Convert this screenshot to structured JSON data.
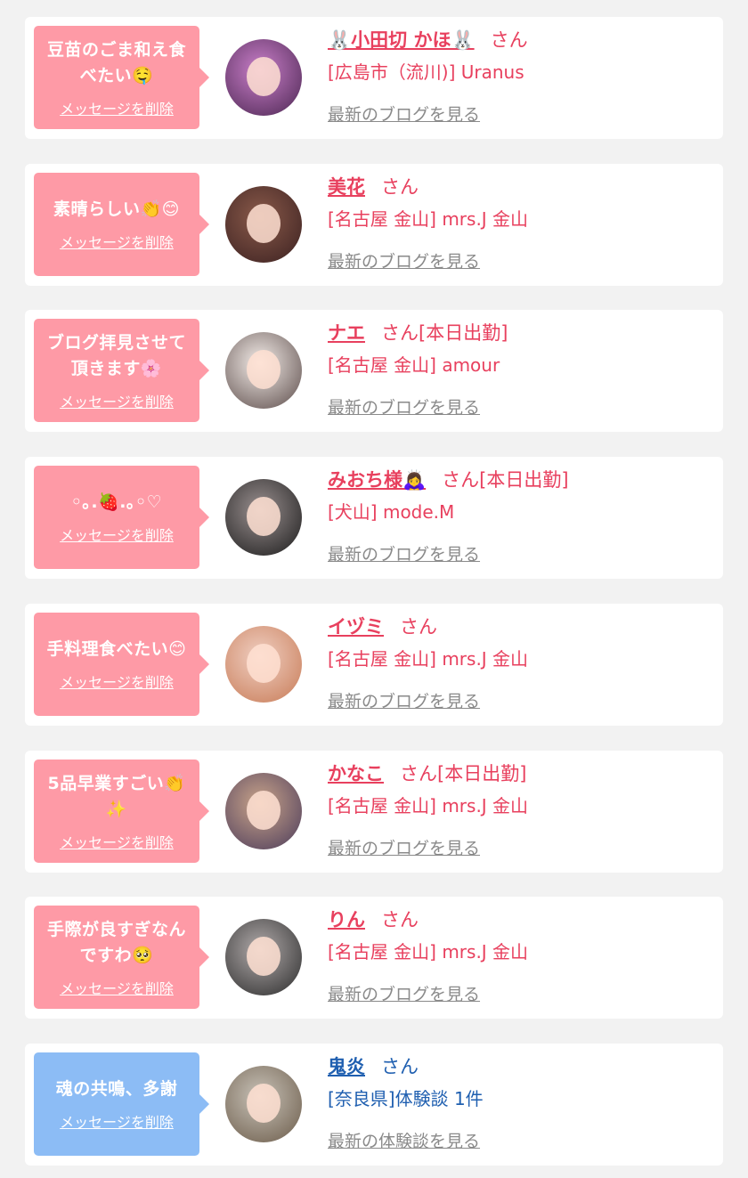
{
  "delete_label": "メッセージを削除",
  "colors": {
    "page_bg": "#f2f2f2",
    "bubble_pink": "#fe9aa6",
    "bubble_blue": "#8cbcf5",
    "text_pink": "#e8405e",
    "text_blue": "#1f5fb0",
    "link_gray": "#8a8a8a"
  },
  "cards": [
    {
      "message": "豆苗のごま和え食べたい🤤",
      "name": "🐰小田切 かほ🐰",
      "suffix": "さん",
      "shop": "[広島市（流川)] Uranus",
      "link": "最新のブログを見る",
      "theme": "pink",
      "avatar_colors": [
        "#c97fc9",
        "#4a2550"
      ]
    },
    {
      "message": "素晴らしい👏😊",
      "name": "美花",
      "suffix": "さん",
      "shop": "[名古屋 金山] mrs.J 金山",
      "link": "最新のブログを見る",
      "theme": "pink",
      "avatar_colors": [
        "#8a5a4a",
        "#3a2020"
      ]
    },
    {
      "message": "ブログ拝見させて頂きます🌸",
      "name": "ナエ",
      "suffix": "さん[本日出勤]",
      "shop": "[名古屋 金山] amour",
      "link": "最新のブログを見る",
      "theme": "pink",
      "avatar_colors": [
        "#f3ece8",
        "#5a4a48"
      ]
    },
    {
      "message": "◦｡.🍓.｡◦♡",
      "name": "みおち様🙇‍♀️",
      "suffix": "さん[本日出勤]",
      "shop": "[犬山] mode.M",
      "link": "最新のブログを見る",
      "theme": "pink",
      "avatar_colors": [
        "#9a9090",
        "#1a1a1a"
      ]
    },
    {
      "message": "手料理食べたい😊",
      "name": "イヅミ",
      "suffix": "さん",
      "shop": "[名古屋 金山] mrs.J 金山",
      "link": "最新のブログを見る",
      "theme": "pink",
      "avatar_colors": [
        "#f0cfc2",
        "#c77a55"
      ]
    },
    {
      "message": "5品早業すごい👏✨",
      "name": "かなこ",
      "suffix": "さん[本日出勤]",
      "shop": "[名古屋 金山] mrs.J 金山",
      "link": "最新のブログを見る",
      "theme": "pink",
      "avatar_colors": [
        "#c9a48a",
        "#4a3a5a"
      ]
    },
    {
      "message": "手際が良すぎなんですわ🥺",
      "name": "りん",
      "suffix": "さん",
      "shop": "[名古屋 金山] mrs.J 金山",
      "link": "最新のブログを見る",
      "theme": "pink",
      "avatar_colors": [
        "#b0aaaa",
        "#2a2a2a"
      ]
    },
    {
      "message": "魂の共鳴、多謝",
      "name": "鬼炎",
      "suffix": "さん",
      "shop": "[奈良県]体験談 1件",
      "link": "最新の体験談を見る",
      "theme": "blue",
      "avatar_colors": [
        "#c8c2b8",
        "#6a5a48"
      ]
    }
  ]
}
